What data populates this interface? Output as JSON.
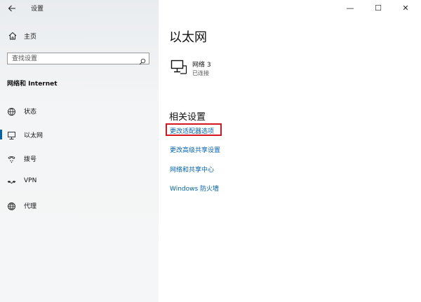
{
  "titlebar": {
    "back_icon": "back-arrow-icon",
    "app_title": "设置"
  },
  "window_controls": {
    "minimize": "—",
    "maximize": "☐",
    "close": "✕"
  },
  "sidebar": {
    "home_label": "主页",
    "search_placeholder": "查找设置",
    "section_title": "网络和 Internet",
    "items": [
      {
        "label": "状态",
        "icon": "globe-status-icon",
        "selected": false
      },
      {
        "label": "以太网",
        "icon": "ethernet-icon",
        "selected": true
      },
      {
        "label": "拨号",
        "icon": "dialup-icon",
        "selected": false
      },
      {
        "label": "VPN",
        "icon": "vpn-icon",
        "selected": false
      },
      {
        "label": "代理",
        "icon": "globe-proxy-icon",
        "selected": false
      }
    ]
  },
  "main": {
    "page_title": "以太网",
    "network": {
      "name": "网络 3",
      "status": "已连接"
    },
    "related_heading": "相关设置",
    "links": [
      {
        "label": "更改适配器选项",
        "highlighted": true
      },
      {
        "label": "更改高级共享设置",
        "highlighted": false
      },
      {
        "label": "网络和共享中心",
        "highlighted": false
      },
      {
        "label": "Windows 防火墙",
        "highlighted": false
      }
    ]
  },
  "colors": {
    "accent": "#0063b1",
    "highlight_border": "#d7171f",
    "sidebar_bg": "#f3f5f6"
  }
}
